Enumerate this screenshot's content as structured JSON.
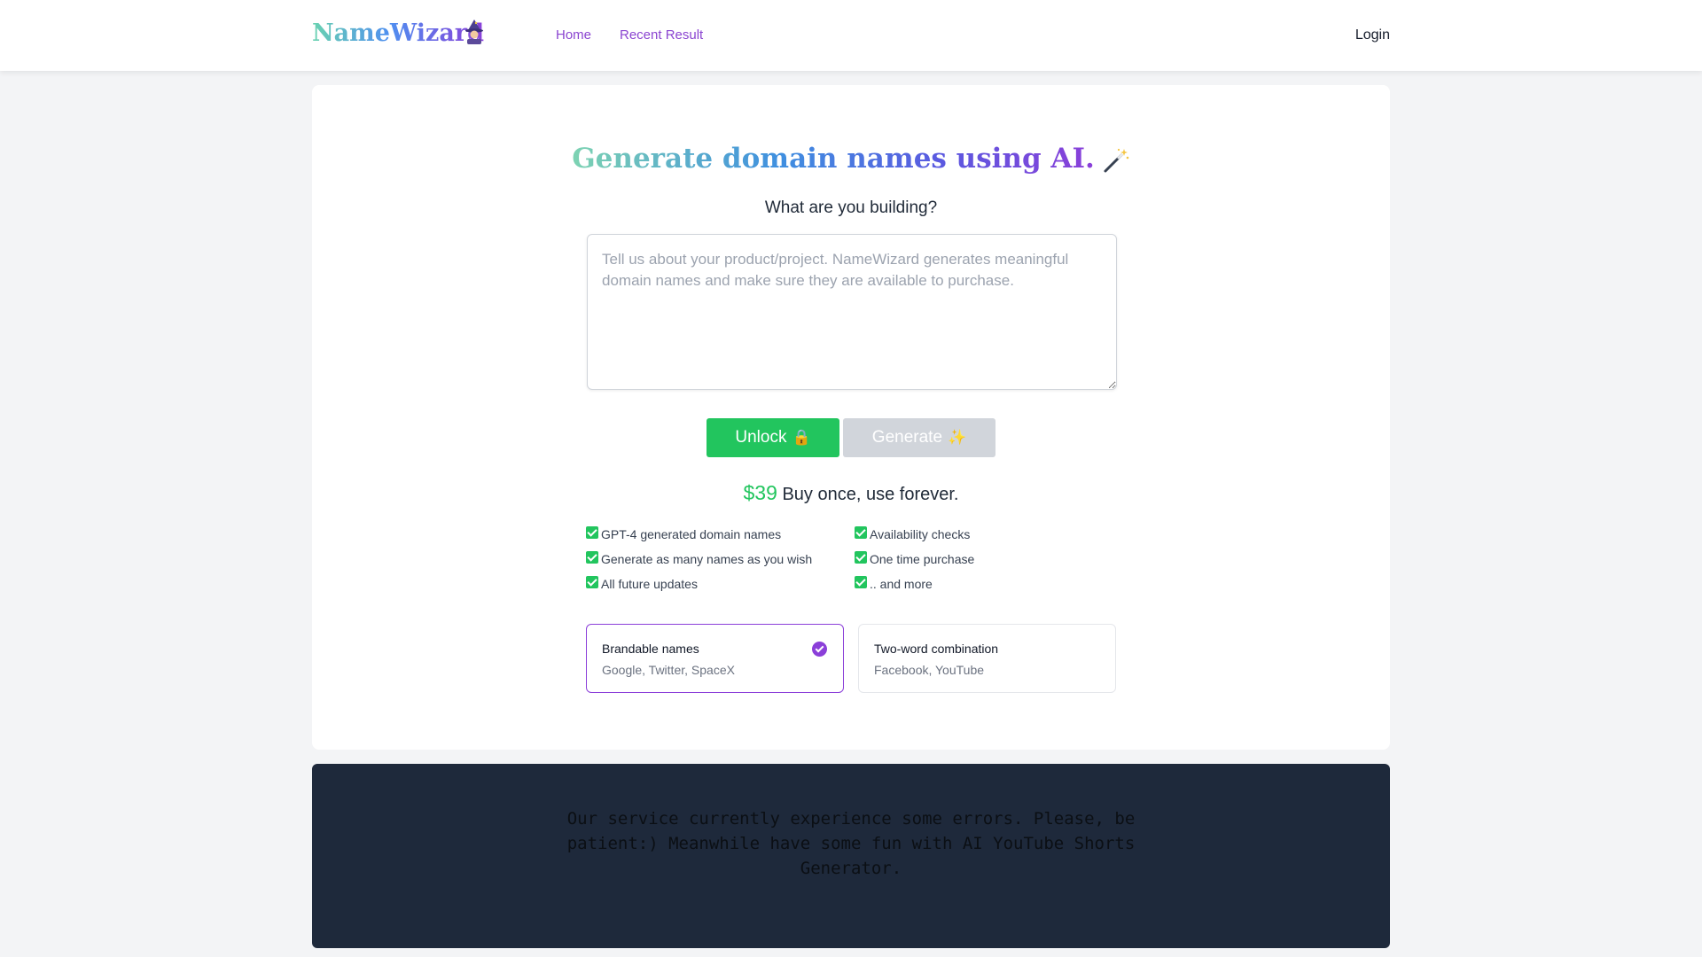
{
  "header": {
    "logo_text": "NameWizard",
    "logo_icon": "wizard-icon",
    "nav": [
      {
        "label": "Home"
      },
      {
        "label": "Recent Result"
      }
    ],
    "login_label": "Login"
  },
  "hero": {
    "title": "Generate domain names using AI.",
    "title_icon": "magic-wand-icon",
    "subtitle": "What are you building?"
  },
  "input": {
    "value": "",
    "placeholder": "Tell us about your product/project. NameWizard generates meaningful domain names and make sure they are available to purchase."
  },
  "buttons": {
    "unlock_label": "Unlock",
    "unlock_icon": "🔒",
    "generate_label": "Generate",
    "generate_icon": "✨"
  },
  "pricing": {
    "amount": "$39",
    "tagline": "Buy once, use forever."
  },
  "features": [
    {
      "label": "GPT-4 generated domain names"
    },
    {
      "label": "Availability checks"
    },
    {
      "label": "Generate as many names as you wish"
    },
    {
      "label": "One time purchase"
    },
    {
      "label": "All future updates"
    },
    {
      "label": ".. and more"
    }
  ],
  "options": [
    {
      "title": "Brandable names",
      "examples": "Google, Twitter, SpaceX",
      "selected": true
    },
    {
      "title": "Two-word combination",
      "examples": "Facebook, YouTube",
      "selected": false
    }
  ],
  "notice": {
    "text": "Our service currently experience some errors. Please, be patient:) Meanwhile have some fun with AI YouTube Shorts Generator."
  },
  "colors": {
    "accent_purple": "#8b3fd9",
    "accent_green": "#22c55e",
    "notice_bg": "#1e293b"
  }
}
